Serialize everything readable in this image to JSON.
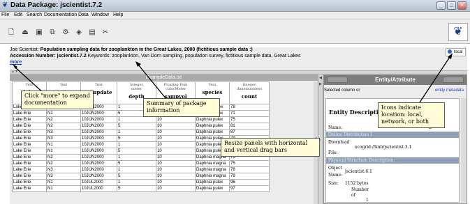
{
  "window": {
    "title": "Data Package:  jscientist.7.2",
    "app_icon": "butterfly-icon"
  },
  "window_controls": {
    "minimize": "_",
    "maximize": "□",
    "close": "✕"
  },
  "menu": [
    "File",
    "Edit",
    "Search",
    "Documentation",
    "Data",
    "Window",
    "Help"
  ],
  "toolbar": {
    "icons": [
      "new-document-icon",
      "open-icon",
      "save-icon",
      "copy-icon",
      "network-icon",
      "transfer-icon",
      "print-icon",
      "tools-icon"
    ]
  },
  "info": {
    "line1_prefix": "Joe Scientist:  ",
    "line1_bold": "Population sampling data for zooplankton in the Great Lakes,     2000 (fictitious sample data :)",
    "accession_label": "Accession Number: jscientist.7.2",
    "keywords": "  Keywords: zooplankton, Van Dorn sampling, population survey, fictitious sample data, Great Lakes",
    "more": "more",
    "location": "local"
  },
  "table": {
    "file": "ExampleData.txt",
    "columns": [
      {
        "type": "Text",
        "unit": "",
        "name": "lake"
      },
      {
        "type": "Text",
        "unit": "",
        "name": "station"
      },
      {
        "type": "Text",
        "unit": "",
        "name": "sampdate"
      },
      {
        "type": "Integer",
        "unit": "meter",
        "name": "depth"
      },
      {
        "type": "Floating Poin",
        "unit": "cubicMeter",
        "name": "sampvol"
      },
      {
        "type": "Text",
        "unit": "",
        "name": "species"
      },
      {
        "type": "Integer",
        "unit": "dimensionless",
        "name": "count"
      }
    ],
    "rows": [
      [
        "Lake Erie",
        "N1",
        "10JUN2000",
        "1",
        "10",
        "Daphnia pulex",
        "78"
      ],
      [
        "Lake Erie",
        "N1",
        "10JUN2000",
        "5",
        "10",
        "Daphnia pulex",
        "71"
      ],
      [
        "Lake Erie",
        "N2",
        "10JUN2000",
        "1",
        "10",
        "Daphnia pulex",
        "75"
      ],
      [
        "Lake Erie",
        "N2",
        "10JUN2000",
        "5",
        "10",
        "Daphnia pulex",
        "81"
      ],
      [
        "Lake Erie",
        "N3",
        "10JUN2000",
        "1",
        "10",
        "Daphnia pulex",
        "87"
      ],
      [
        "Lake Erie",
        "N3",
        "10JUN2000",
        "5",
        "10",
        "Daphnia pulex",
        "79"
      ],
      [
        "Lake Erie",
        "N1",
        "10JUN2000",
        "1",
        "10",
        "Daphnia pulex",
        "80"
      ],
      [
        "Lake Erie",
        "N1",
        "10JUN2000",
        "5",
        "10",
        "Daphnia pulex",
        "83"
      ],
      [
        "Lake Erie",
        "N2",
        "10JUN2000",
        "1",
        "10",
        "Daphnia magna",
        "75"
      ],
      [
        "Lake Erie",
        "N2",
        "10JUN2000",
        "5",
        "10",
        "Daphnia magna",
        "75"
      ],
      [
        "Lake Erie",
        "N3",
        "10JUN2000",
        "1",
        "10",
        "Daphnia magna",
        "78"
      ],
      [
        "Lake Erie",
        "N3",
        "10JUN2000",
        "5",
        "10",
        "Daphnia magna",
        "79"
      ],
      [
        "Lake Erie",
        "N1",
        "10JUL2000",
        "1",
        "10",
        "Daphnia pulex",
        "96"
      ],
      [
        "Lake Erie",
        "N1",
        "10JUL2000",
        "5",
        "10",
        "Daphnia pulex",
        "97"
      ]
    ]
  },
  "entity": {
    "header": "Entity/Attribute",
    "selected_label": "Selected column or",
    "metadata_link": "entity metadata",
    "description_title": "Entity Description",
    "name_label": "Name:",
    "name_value": "E",
    "online_distribution": "Online Distribution I",
    "download_label": "Download",
    "file_label": "File:",
    "download_value": "ecogrid://knb/jscientist.3.1",
    "physical_structure": "Physical Structure Description:",
    "object_label": "Object",
    "object_name_label": "Name:",
    "object_value": "jscientist.6.1",
    "size_label": "Size:",
    "size_value": "1152 bytes",
    "number_label": "Number",
    "of_label": "of",
    "records_value": "1"
  },
  "callouts": {
    "more": "Click \"more\" to expand documentation",
    "summary": "Summary of package information",
    "location": "Icons indicate location: local, network, or both",
    "resize": "Resize panels with horizontal and vertical drag bars"
  }
}
